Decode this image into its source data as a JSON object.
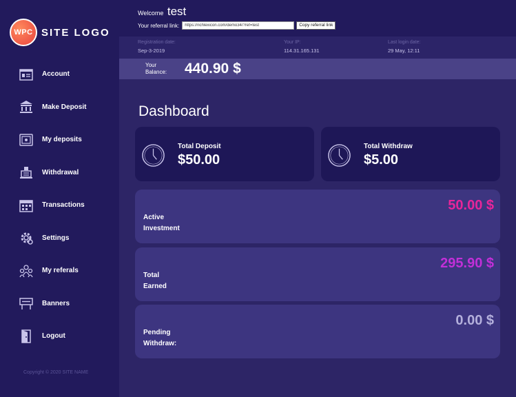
{
  "logo": {
    "badge": "WPC",
    "text": "SITE LOGO"
  },
  "sidebar": {
    "items": [
      {
        "label": "Account",
        "icon": "account-icon"
      },
      {
        "label": "Make Deposit",
        "icon": "bank-icon"
      },
      {
        "label": "My deposits",
        "icon": "safe-icon"
      },
      {
        "label": "Withdrawal",
        "icon": "withdraw-icon"
      },
      {
        "label": "Transactions",
        "icon": "calendar-icon"
      },
      {
        "label": "Settings",
        "icon": "gear-icon"
      },
      {
        "label": "My referals",
        "icon": "users-icon"
      },
      {
        "label": "Banners",
        "icon": "banner-icon"
      },
      {
        "label": "Logout",
        "icon": "door-icon"
      }
    ],
    "copyright": "Copyright © 2020 SITE NAME"
  },
  "header": {
    "welcome_label": "Welcome",
    "username": "test",
    "referral_label": "Your referral link:",
    "referral_value": "https://richlexicon.com/demo34/?ref=test",
    "copy_button": "Copy referral link"
  },
  "info": {
    "registration_label": "Registration date:",
    "registration_value": "Sep-3-2019",
    "ip_label": "Your IP:",
    "ip_value": "114.31.165.131",
    "last_login_label": "Last login date:",
    "last_login_value": "29 May, 12:11"
  },
  "balance": {
    "label_line1": "Your",
    "label_line2": "Balance:",
    "value": "440.90 $"
  },
  "dashboard": {
    "title": "Dashboard",
    "total_deposit_label": "Total Deposit",
    "total_deposit_value": "$50.00",
    "total_withdraw_label": "Total Withdraw",
    "total_withdraw_value": "$5.00",
    "stats": [
      {
        "line1": "Active",
        "line2": "Investment",
        "value": "50.00 $",
        "color": "#e8259a"
      },
      {
        "line1": "Total",
        "line2": "Earned",
        "value": "295.90 $",
        "color": "#c22fd8"
      },
      {
        "line1": "Pending",
        "line2": "Withdraw:",
        "value": "0.00 $",
        "color": "#b4b0dc"
      }
    ]
  }
}
